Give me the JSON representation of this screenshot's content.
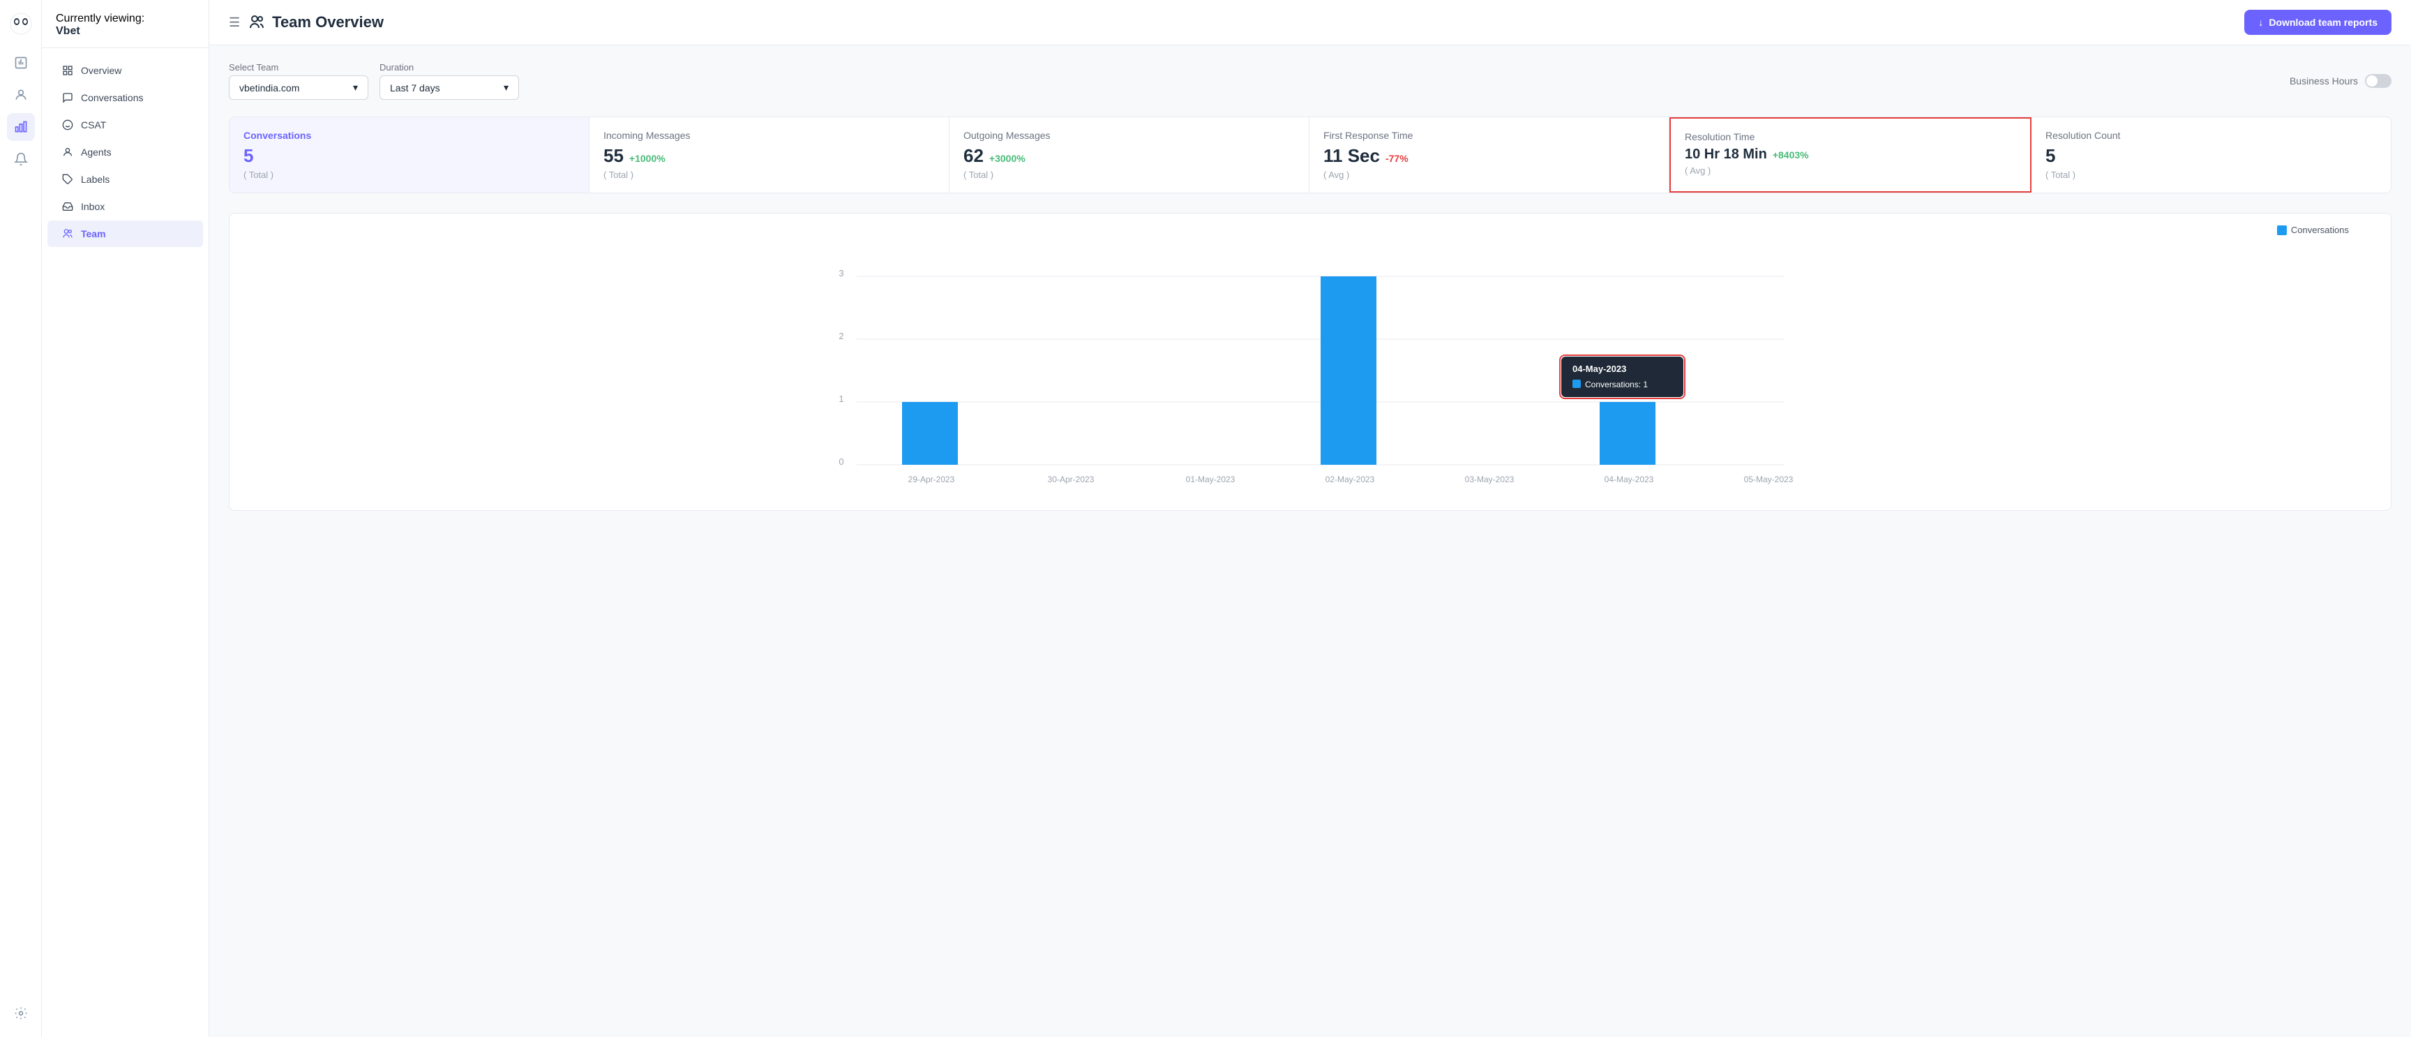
{
  "app": {
    "logo_text": "🐼",
    "workspace_label": "Currently viewing:",
    "workspace_name": "Vbet"
  },
  "topbar": {
    "menu_icon": "☰",
    "page_icon": "👥",
    "page_title": "Team Overview",
    "download_icon": "↓",
    "download_label": "Download team reports"
  },
  "filters": {
    "team_label": "Select Team",
    "team_value": "vbetindia.com",
    "duration_label": "Duration",
    "duration_value": "Last 7 days",
    "business_hours_label": "Business Hours"
  },
  "metrics": [
    {
      "id": "conversations",
      "title": "Conversations",
      "value": "5",
      "change": "",
      "sub": "( Total )",
      "active": true,
      "highlighted": false
    },
    {
      "id": "incoming",
      "title": "Incoming Messages",
      "value": "55",
      "change": "+1000%",
      "change_type": "positive",
      "sub": "( Total )",
      "active": false,
      "highlighted": false
    },
    {
      "id": "outgoing",
      "title": "Outgoing Messages",
      "value": "62",
      "change": "+3000%",
      "change_type": "positive",
      "sub": "( Total )",
      "active": false,
      "highlighted": false
    },
    {
      "id": "first_response",
      "title": "First Response Time",
      "value": "11 Sec",
      "change": "-77%",
      "change_type": "negative",
      "sub": "( Avg )",
      "active": false,
      "highlighted": false
    },
    {
      "id": "resolution_time",
      "title": "Resolution Time",
      "value": "10 Hr 18 Min",
      "change": "+8403%",
      "change_type": "positive",
      "sub": "( Avg )",
      "active": false,
      "highlighted": true
    },
    {
      "id": "resolution_count",
      "title": "Resolution Count",
      "value": "5",
      "change": "",
      "sub": "( Total )",
      "active": false,
      "highlighted": false
    }
  ],
  "chart": {
    "legend_label": "Conversations",
    "bars": [
      {
        "date": "29-Apr-2023",
        "value": 1
      },
      {
        "date": "30-Apr-2023",
        "value": 0
      },
      {
        "date": "01-May-2023",
        "value": 0
      },
      {
        "date": "02-May-2023",
        "value": 3
      },
      {
        "date": "03-May-2023",
        "value": 0
      },
      {
        "date": "04-May-2023",
        "value": 1
      },
      {
        "date": "05-May-2023",
        "value": 0
      }
    ],
    "y_labels": [
      "0",
      "1",
      "2",
      "3"
    ],
    "tooltip": {
      "date": "04-May-2023",
      "label": "Conversations: 1"
    }
  },
  "nav": {
    "items": [
      {
        "id": "overview",
        "label": "Overview",
        "active": false
      },
      {
        "id": "conversations",
        "label": "Conversations",
        "active": false
      },
      {
        "id": "csat",
        "label": "CSAT",
        "active": false
      },
      {
        "id": "agents",
        "label": "Agents",
        "active": false
      },
      {
        "id": "labels",
        "label": "Labels",
        "active": false
      },
      {
        "id": "inbox",
        "label": "Inbox",
        "active": false
      },
      {
        "id": "team",
        "label": "Team",
        "active": true
      }
    ]
  }
}
